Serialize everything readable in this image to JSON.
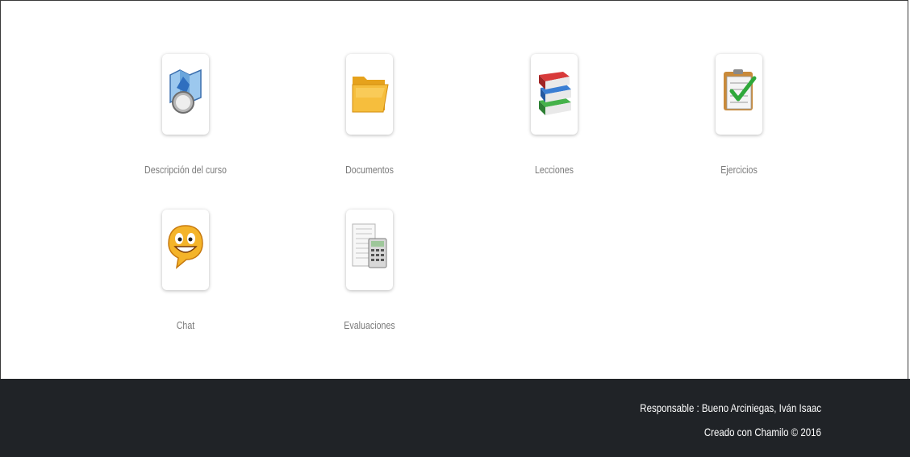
{
  "tools": [
    {
      "label": "Descripción del curso",
      "icon": "course-description-icon"
    },
    {
      "label": "Documentos",
      "icon": "folder-icon"
    },
    {
      "label": "Lecciones",
      "icon": "books-icon"
    },
    {
      "label": "Ejercicios",
      "icon": "quiz-checklist-icon"
    },
    {
      "label": "Chat",
      "icon": "smiley-chat-icon"
    },
    {
      "label": "Evaluaciones",
      "icon": "gradebook-calculator-icon"
    }
  ],
  "footer": {
    "responsible": "Responsable : Bueno Arciniegas, Iván Isaac",
    "credits": "Creado con Chamilo © 2016"
  },
  "colors": {
    "footer_bg": "#202327",
    "label_text": "#7a7a7a"
  }
}
